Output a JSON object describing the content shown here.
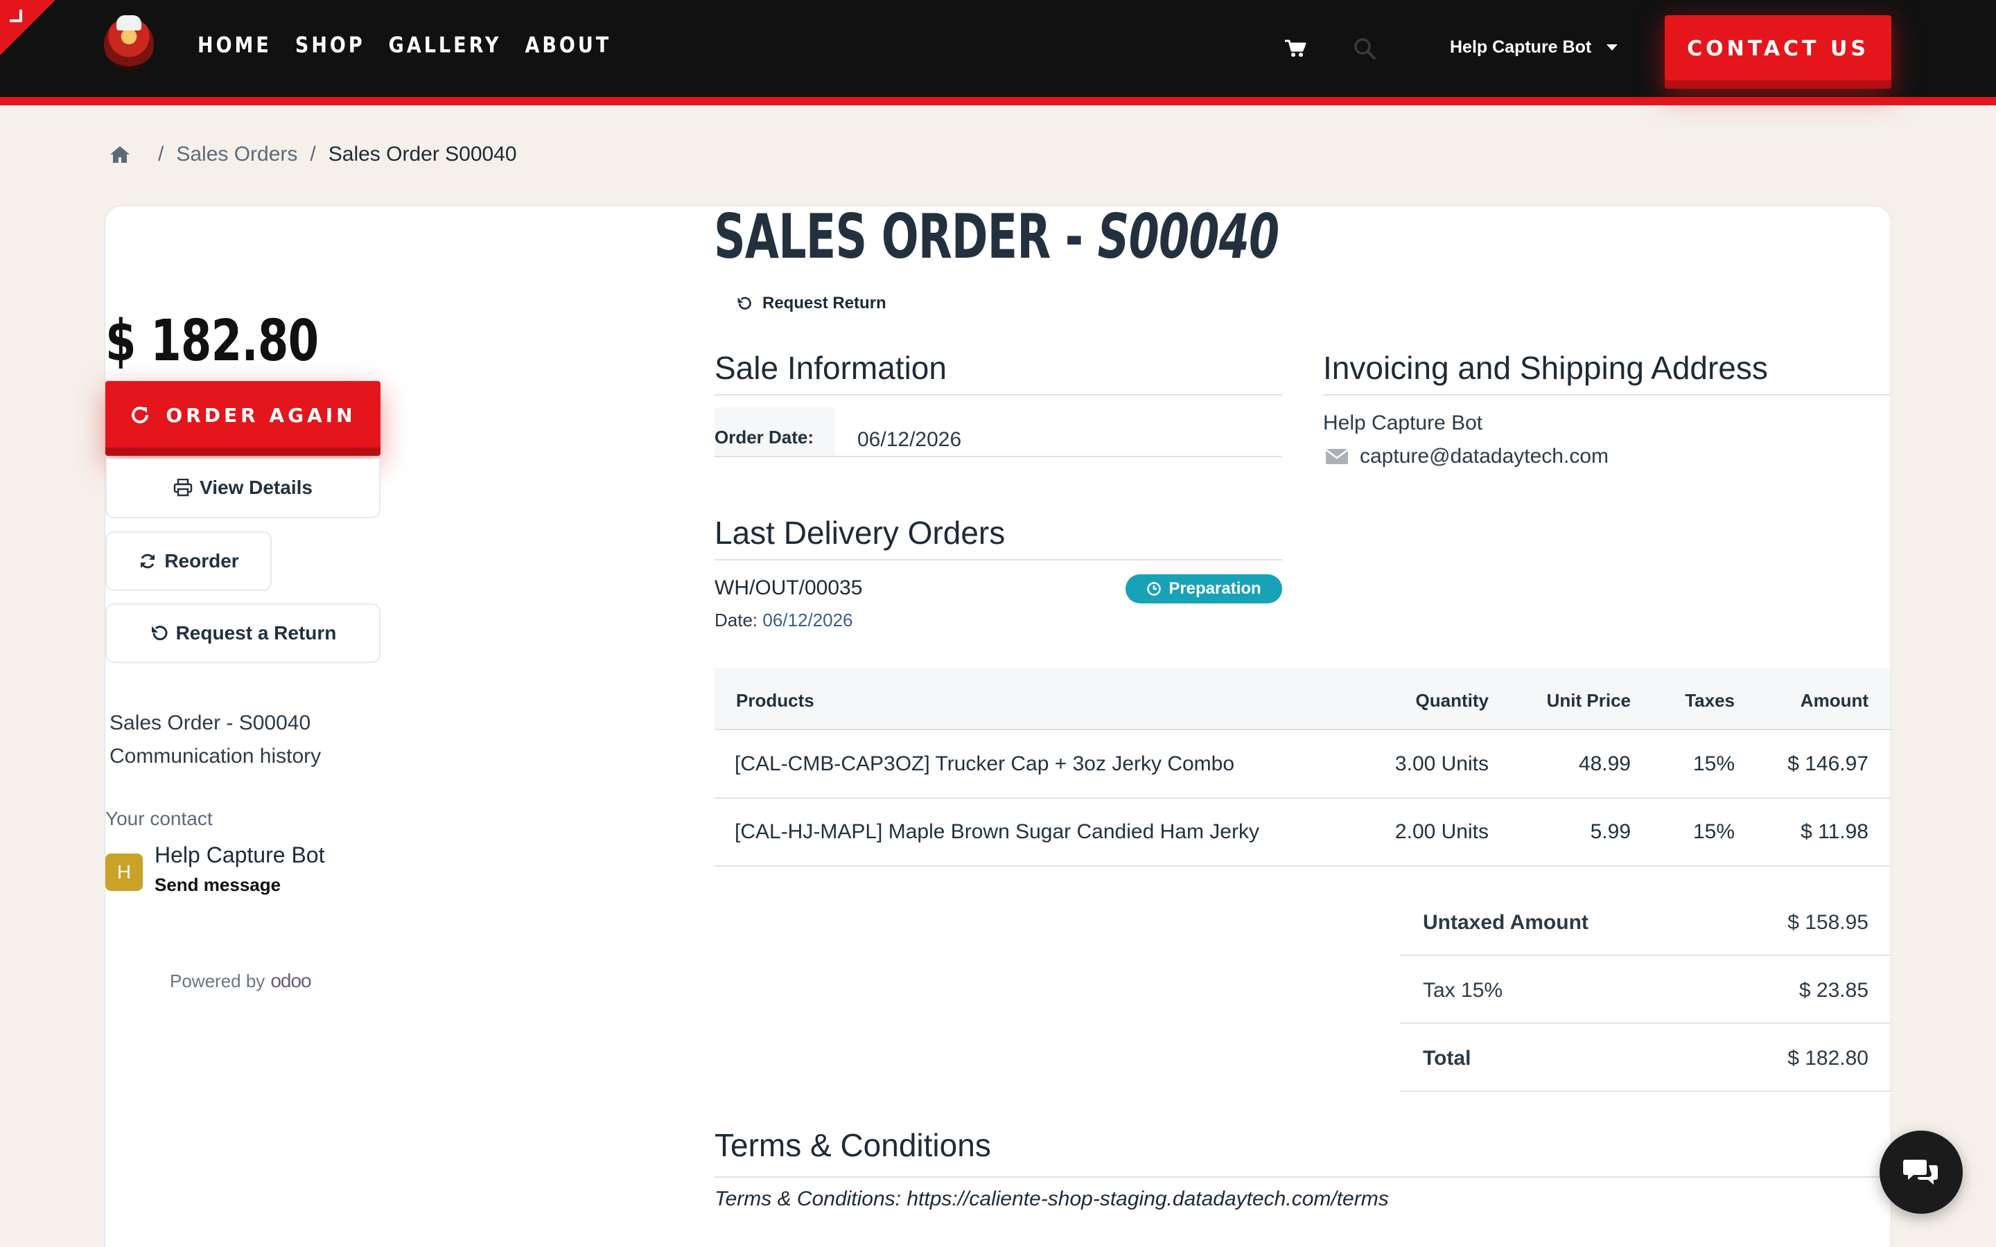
{
  "nav": {
    "items": [
      "HOME",
      "SHOP",
      "GALLERY",
      "ABOUT"
    ]
  },
  "header": {
    "user_name": "Help Capture Bot",
    "contact_label": "CONTACT US"
  },
  "breadcrumb": {
    "parent": "Sales Orders",
    "sep": "/",
    "current": "Sales Order S00040"
  },
  "sidebar": {
    "total": "$ 182.80",
    "order_again": "ORDER AGAIN",
    "view_details": "View Details",
    "reorder": "Reorder",
    "request_return": "Request a Return",
    "so_line1": "Sales Order - S00040",
    "so_line2": "Communication history",
    "contact_label": "Your contact",
    "avatar_letter": "H",
    "contact_name": "Help Capture Bot",
    "send_message": "Send message",
    "powered_by": "Powered by",
    "odoo_brand": "odoo"
  },
  "main": {
    "title_prefix": "SALES ORDER - ",
    "title_ref": "S00040",
    "request_return": "Request Return",
    "sale_info_title": "Sale Information",
    "order_date_label": "Order Date:",
    "order_date": "06/12/2026",
    "address_title": "Invoicing and Shipping Address",
    "address_name": "Help Capture Bot",
    "address_email": "capture@datadaytech.com",
    "delivery_title": "Last Delivery Orders",
    "delivery_ref": "WH/OUT/00035",
    "delivery_date_label": "Date:",
    "delivery_date": "06/12/2026",
    "delivery_status": "Preparation",
    "terms_title": "Terms & Conditions",
    "terms_text": "Terms & Conditions: https://caliente-shop-staging.datadaytech.com/terms"
  },
  "table": {
    "headers": {
      "product": "Products",
      "qty": "Quantity",
      "price": "Unit Price",
      "taxes": "Taxes",
      "amount": "Amount"
    },
    "rows": [
      {
        "product": "[CAL-CMB-CAP3OZ] Trucker Cap + 3oz Jerky Combo",
        "qty": "3.00 Units",
        "price": "48.99",
        "taxes": "15%",
        "amount": "$ 146.97"
      },
      {
        "product": "[CAL-HJ-MAPL] Maple Brown Sugar Candied Ham Jerky",
        "qty": "2.00 Units",
        "price": "5.99",
        "taxes": "15%",
        "amount": "$ 11.98"
      }
    ]
  },
  "totals": {
    "untaxed_label": "Untaxed Amount",
    "untaxed": "$ 158.95",
    "tax_label": "Tax 15%",
    "tax": "$ 23.85",
    "total_label": "Total",
    "total": "$ 182.80"
  },
  "colors": {
    "brand_red": "#e4161b",
    "header_bg": "#111112",
    "page_bg": "#f5f0ea",
    "status_teal": "#17a2b8",
    "avatar": "#c9a227"
  },
  "icons": [
    "home-icon",
    "cart-icon",
    "search-icon",
    "refresh-icon",
    "printer-icon",
    "reorder-icon",
    "undo-icon",
    "envelope-icon",
    "clock-icon",
    "chat-icon",
    "chevron-down-icon"
  ]
}
